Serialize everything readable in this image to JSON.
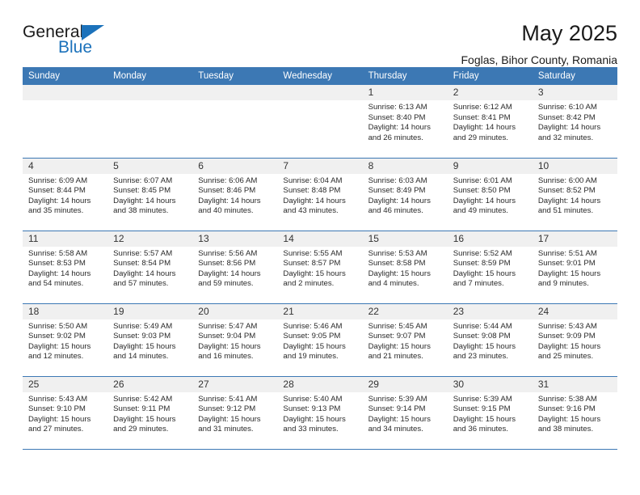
{
  "brand": {
    "name_part1": "General",
    "name_part2": "Blue",
    "logo_icon": "triangle-logo-icon"
  },
  "header": {
    "title": "May 2025",
    "subtitle": "Foglas, Bihor County, Romania"
  },
  "colors": {
    "header_blue": "#3c78b4",
    "brand_blue": "#1c72bb",
    "daynum_band": "#f0f0f0"
  },
  "weekday_headers": [
    "Sunday",
    "Monday",
    "Tuesday",
    "Wednesday",
    "Thursday",
    "Friday",
    "Saturday"
  ],
  "labels": {
    "sunrise_prefix": "Sunrise:",
    "sunset_prefix": "Sunset:",
    "daylight_prefix": "Daylight:"
  },
  "weeks": [
    [
      {
        "day": "",
        "sunrise": "",
        "sunset": "",
        "daylight_line1": "",
        "daylight_line2": ""
      },
      {
        "day": "",
        "sunrise": "",
        "sunset": "",
        "daylight_line1": "",
        "daylight_line2": ""
      },
      {
        "day": "",
        "sunrise": "",
        "sunset": "",
        "daylight_line1": "",
        "daylight_line2": ""
      },
      {
        "day": "",
        "sunrise": "",
        "sunset": "",
        "daylight_line1": "",
        "daylight_line2": ""
      },
      {
        "day": "1",
        "sunrise": "Sunrise: 6:13 AM",
        "sunset": "Sunset: 8:40 PM",
        "daylight_line1": "Daylight: 14 hours",
        "daylight_line2": "and 26 minutes."
      },
      {
        "day": "2",
        "sunrise": "Sunrise: 6:12 AM",
        "sunset": "Sunset: 8:41 PM",
        "daylight_line1": "Daylight: 14 hours",
        "daylight_line2": "and 29 minutes."
      },
      {
        "day": "3",
        "sunrise": "Sunrise: 6:10 AM",
        "sunset": "Sunset: 8:42 PM",
        "daylight_line1": "Daylight: 14 hours",
        "daylight_line2": "and 32 minutes."
      }
    ],
    [
      {
        "day": "4",
        "sunrise": "Sunrise: 6:09 AM",
        "sunset": "Sunset: 8:44 PM",
        "daylight_line1": "Daylight: 14 hours",
        "daylight_line2": "and 35 minutes."
      },
      {
        "day": "5",
        "sunrise": "Sunrise: 6:07 AM",
        "sunset": "Sunset: 8:45 PM",
        "daylight_line1": "Daylight: 14 hours",
        "daylight_line2": "and 38 minutes."
      },
      {
        "day": "6",
        "sunrise": "Sunrise: 6:06 AM",
        "sunset": "Sunset: 8:46 PM",
        "daylight_line1": "Daylight: 14 hours",
        "daylight_line2": "and 40 minutes."
      },
      {
        "day": "7",
        "sunrise": "Sunrise: 6:04 AM",
        "sunset": "Sunset: 8:48 PM",
        "daylight_line1": "Daylight: 14 hours",
        "daylight_line2": "and 43 minutes."
      },
      {
        "day": "8",
        "sunrise": "Sunrise: 6:03 AM",
        "sunset": "Sunset: 8:49 PM",
        "daylight_line1": "Daylight: 14 hours",
        "daylight_line2": "and 46 minutes."
      },
      {
        "day": "9",
        "sunrise": "Sunrise: 6:01 AM",
        "sunset": "Sunset: 8:50 PM",
        "daylight_line1": "Daylight: 14 hours",
        "daylight_line2": "and 49 minutes."
      },
      {
        "day": "10",
        "sunrise": "Sunrise: 6:00 AM",
        "sunset": "Sunset: 8:52 PM",
        "daylight_line1": "Daylight: 14 hours",
        "daylight_line2": "and 51 minutes."
      }
    ],
    [
      {
        "day": "11",
        "sunrise": "Sunrise: 5:58 AM",
        "sunset": "Sunset: 8:53 PM",
        "daylight_line1": "Daylight: 14 hours",
        "daylight_line2": "and 54 minutes."
      },
      {
        "day": "12",
        "sunrise": "Sunrise: 5:57 AM",
        "sunset": "Sunset: 8:54 PM",
        "daylight_line1": "Daylight: 14 hours",
        "daylight_line2": "and 57 minutes."
      },
      {
        "day": "13",
        "sunrise": "Sunrise: 5:56 AM",
        "sunset": "Sunset: 8:56 PM",
        "daylight_line1": "Daylight: 14 hours",
        "daylight_line2": "and 59 minutes."
      },
      {
        "day": "14",
        "sunrise": "Sunrise: 5:55 AM",
        "sunset": "Sunset: 8:57 PM",
        "daylight_line1": "Daylight: 15 hours",
        "daylight_line2": "and 2 minutes."
      },
      {
        "day": "15",
        "sunrise": "Sunrise: 5:53 AM",
        "sunset": "Sunset: 8:58 PM",
        "daylight_line1": "Daylight: 15 hours",
        "daylight_line2": "and 4 minutes."
      },
      {
        "day": "16",
        "sunrise": "Sunrise: 5:52 AM",
        "sunset": "Sunset: 8:59 PM",
        "daylight_line1": "Daylight: 15 hours",
        "daylight_line2": "and 7 minutes."
      },
      {
        "day": "17",
        "sunrise": "Sunrise: 5:51 AM",
        "sunset": "Sunset: 9:01 PM",
        "daylight_line1": "Daylight: 15 hours",
        "daylight_line2": "and 9 minutes."
      }
    ],
    [
      {
        "day": "18",
        "sunrise": "Sunrise: 5:50 AM",
        "sunset": "Sunset: 9:02 PM",
        "daylight_line1": "Daylight: 15 hours",
        "daylight_line2": "and 12 minutes."
      },
      {
        "day": "19",
        "sunrise": "Sunrise: 5:49 AM",
        "sunset": "Sunset: 9:03 PM",
        "daylight_line1": "Daylight: 15 hours",
        "daylight_line2": "and 14 minutes."
      },
      {
        "day": "20",
        "sunrise": "Sunrise: 5:47 AM",
        "sunset": "Sunset: 9:04 PM",
        "daylight_line1": "Daylight: 15 hours",
        "daylight_line2": "and 16 minutes."
      },
      {
        "day": "21",
        "sunrise": "Sunrise: 5:46 AM",
        "sunset": "Sunset: 9:05 PM",
        "daylight_line1": "Daylight: 15 hours",
        "daylight_line2": "and 19 minutes."
      },
      {
        "day": "22",
        "sunrise": "Sunrise: 5:45 AM",
        "sunset": "Sunset: 9:07 PM",
        "daylight_line1": "Daylight: 15 hours",
        "daylight_line2": "and 21 minutes."
      },
      {
        "day": "23",
        "sunrise": "Sunrise: 5:44 AM",
        "sunset": "Sunset: 9:08 PM",
        "daylight_line1": "Daylight: 15 hours",
        "daylight_line2": "and 23 minutes."
      },
      {
        "day": "24",
        "sunrise": "Sunrise: 5:43 AM",
        "sunset": "Sunset: 9:09 PM",
        "daylight_line1": "Daylight: 15 hours",
        "daylight_line2": "and 25 minutes."
      }
    ],
    [
      {
        "day": "25",
        "sunrise": "Sunrise: 5:43 AM",
        "sunset": "Sunset: 9:10 PM",
        "daylight_line1": "Daylight: 15 hours",
        "daylight_line2": "and 27 minutes."
      },
      {
        "day": "26",
        "sunrise": "Sunrise: 5:42 AM",
        "sunset": "Sunset: 9:11 PM",
        "daylight_line1": "Daylight: 15 hours",
        "daylight_line2": "and 29 minutes."
      },
      {
        "day": "27",
        "sunrise": "Sunrise: 5:41 AM",
        "sunset": "Sunset: 9:12 PM",
        "daylight_line1": "Daylight: 15 hours",
        "daylight_line2": "and 31 minutes."
      },
      {
        "day": "28",
        "sunrise": "Sunrise: 5:40 AM",
        "sunset": "Sunset: 9:13 PM",
        "daylight_line1": "Daylight: 15 hours",
        "daylight_line2": "and 33 minutes."
      },
      {
        "day": "29",
        "sunrise": "Sunrise: 5:39 AM",
        "sunset": "Sunset: 9:14 PM",
        "daylight_line1": "Daylight: 15 hours",
        "daylight_line2": "and 34 minutes."
      },
      {
        "day": "30",
        "sunrise": "Sunrise: 5:39 AM",
        "sunset": "Sunset: 9:15 PM",
        "daylight_line1": "Daylight: 15 hours",
        "daylight_line2": "and 36 minutes."
      },
      {
        "day": "31",
        "sunrise": "Sunrise: 5:38 AM",
        "sunset": "Sunset: 9:16 PM",
        "daylight_line1": "Daylight: 15 hours",
        "daylight_line2": "and 38 minutes."
      }
    ]
  ]
}
